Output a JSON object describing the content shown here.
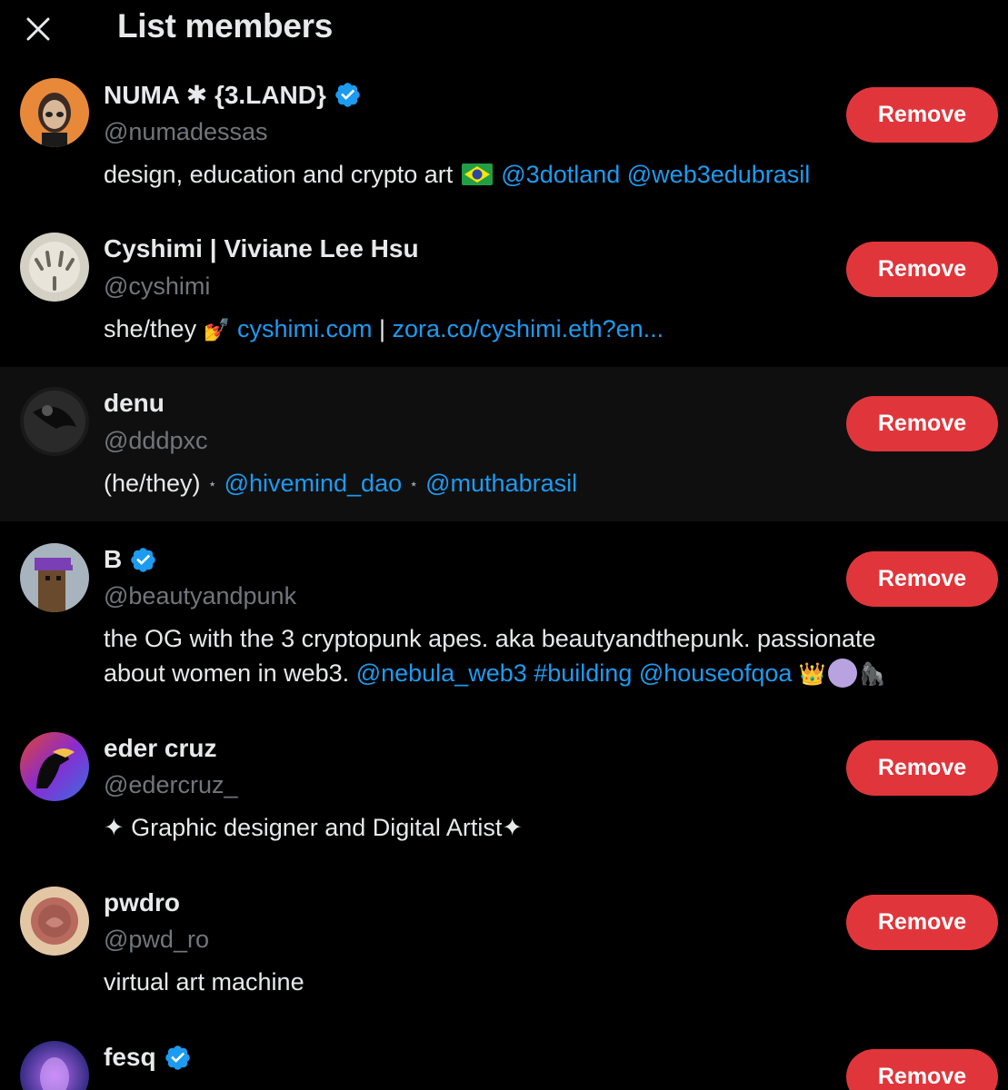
{
  "header": {
    "title": "List members"
  },
  "members": [
    {
      "name": "NUMA ✱ {3.LAND}",
      "verified": true,
      "handle": "@numadessas",
      "bio_parts": [
        "design, education and crypto art ",
        "",
        " @3dotland @web3edubrasil"
      ],
      "remove_label": "Remove"
    },
    {
      "name": "Cyshimi | Viviane Lee Hsu",
      "verified": false,
      "handle": "@cyshimi",
      "bio_parts": [
        "she/they ",
        "💅",
        " cyshimi.com",
        " | ",
        "zora.co/cyshimi.eth?en..."
      ],
      "remove_label": "Remove"
    },
    {
      "name": "denu",
      "verified": false,
      "handle": "@dddpxc",
      "bio_parts": [
        "(he/they)",
        "⋆",
        "@hivemind_dao",
        "⋆",
        "@muthabrasil"
      ],
      "remove_label": "Remove"
    },
    {
      "name": "B",
      "verified": true,
      "handle": "@beautyandpunk",
      "bio_line1": "the OG with the 3 cryptopunk apes. aka beautyandthepunk. passionate",
      "bio_line2_text": "about women in web3. ",
      "bio_line2_links": "@nebula_web3 #building @houseofqoa",
      "bio_line2_emoji": [
        "👑",
        "",
        "🦍"
      ],
      "remove_label": "Remove"
    },
    {
      "name": "eder cruz",
      "verified": false,
      "handle": "@edercruz_",
      "bio": "✦ Graphic designer and Digital Artist✦",
      "remove_label": "Remove"
    },
    {
      "name": "pwdro",
      "verified": false,
      "handle": "@pwd_ro",
      "bio": "virtual art machine",
      "remove_label": "Remove"
    },
    {
      "name": "fesq",
      "verified": true,
      "handle": "",
      "remove_label": "Remove"
    }
  ],
  "colors": {
    "background": "#000000",
    "text": "#e7e9ea",
    "muted": "#71767b",
    "link": "#1d9bf0",
    "remove": "#e0363b",
    "verified": "#1d9bf0"
  }
}
